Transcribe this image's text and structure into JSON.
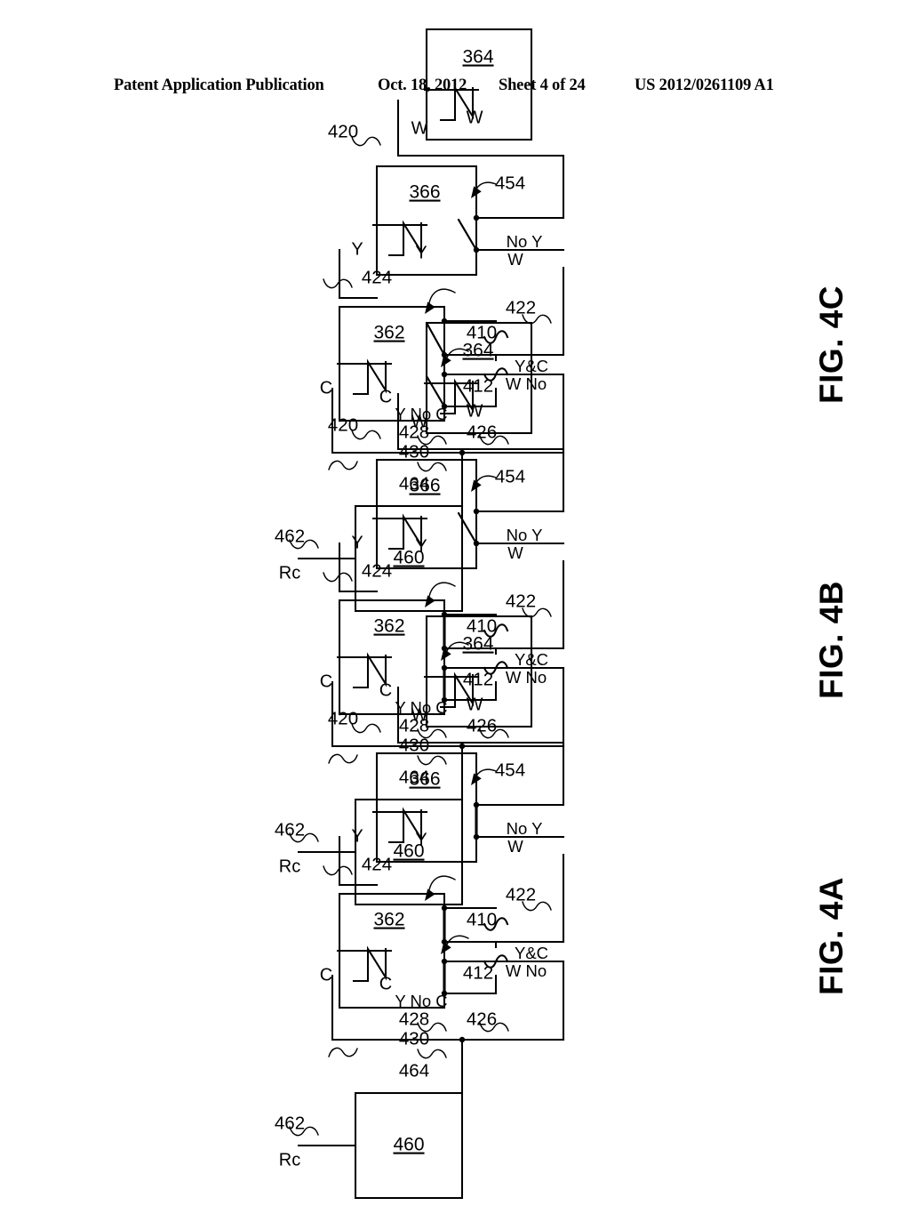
{
  "header": {
    "publication": "Patent Application Publication",
    "date": "Oct. 18, 2012",
    "sheet": "Sheet 4 of 24",
    "patent_number": "US 2012/0261109 A1"
  },
  "figures": [
    {
      "id": "fig-4c",
      "caption": "FIG. 4C",
      "controller_box": "460",
      "power_terminal": "Rc",
      "power_ref": "462",
      "leaders": [
        "464",
        "430",
        "428",
        "426",
        "422",
        "424",
        "420",
        "410",
        "412",
        "454"
      ],
      "wire_labels": {
        "y_no_c": "Y No C",
        "w_no_yc": "W No\nY&C",
        "w_no_y": "W No Y"
      },
      "relays": [
        {
          "ref": "362",
          "coil_terminal": "C",
          "contact_terminal": "C",
          "contacts": [
            {
              "ref": "412",
              "state": "open"
            },
            {
              "ref": "410",
              "state": "open"
            }
          ]
        },
        {
          "ref": "366",
          "coil_terminal": "Y",
          "contact_terminal": "Y",
          "contacts": [
            {
              "ref": "454",
              "state": "open"
            }
          ]
        },
        {
          "ref": "364",
          "coil_terminal": "W",
          "contact_terminal": "W",
          "contacts": []
        }
      ]
    },
    {
      "id": "fig-4b",
      "caption": "FIG. 4B",
      "controller_box": "460",
      "power_terminal": "Rc",
      "power_ref": "462",
      "leaders": [
        "464",
        "430",
        "428",
        "426",
        "422",
        "424",
        "420",
        "410",
        "412",
        "454"
      ],
      "wire_labels": {
        "y_no_c": "Y No C",
        "w_no_yc": "W No\nY&C",
        "w_no_y": "W No Y"
      },
      "relays": [
        {
          "ref": "362",
          "coil_terminal": "C",
          "contact_terminal": "C",
          "contacts": [
            {
              "ref": "412",
              "state": "closed"
            },
            {
              "ref": "410",
              "state": "closed"
            }
          ]
        },
        {
          "ref": "366",
          "coil_terminal": "Y",
          "contact_terminal": "Y",
          "contacts": [
            {
              "ref": "454",
              "state": "open"
            }
          ]
        },
        {
          "ref": "364",
          "coil_terminal": "W",
          "contact_terminal": "W",
          "contacts": []
        }
      ]
    },
    {
      "id": "fig-4a",
      "caption": "FIG. 4A",
      "controller_box": "460",
      "power_terminal": "Rc",
      "power_ref": "462",
      "leaders": [
        "464",
        "430",
        "428",
        "426",
        "422",
        "424",
        "420",
        "410",
        "412",
        "454"
      ],
      "wire_labels": {
        "y_no_c": "Y No C",
        "w_no_yc": "W No\nY&C",
        "w_no_y": "W No Y"
      },
      "relays": [
        {
          "ref": "362",
          "coil_terminal": "C",
          "contact_terminal": "C",
          "contacts": [
            {
              "ref": "412",
              "state": "closed"
            },
            {
              "ref": "410",
              "state": "closed"
            }
          ]
        },
        {
          "ref": "366",
          "coil_terminal": "Y",
          "contact_terminal": "Y",
          "contacts": [
            {
              "ref": "454",
              "state": "closed"
            }
          ]
        },
        {
          "ref": "364",
          "coil_terminal": "W",
          "contact_terminal": "W",
          "contacts": []
        }
      ]
    }
  ],
  "labels": {
    "ref_420": "420",
    "ref_422": "422",
    "ref_424": "424",
    "ref_426": "426",
    "ref_428": "428",
    "ref_430": "430",
    "ref_410": "410",
    "ref_412": "412",
    "ref_454": "454",
    "ref_460": "460",
    "ref_462": "462",
    "ref_464": "464",
    "ref_362": "362",
    "ref_364": "364",
    "ref_366": "366",
    "term_rc": "Rc",
    "term_c": "C",
    "term_y": "Y",
    "term_w": "W",
    "txt_y_no_c": "Y No C",
    "txt_w_no_yc_1": "W No",
    "txt_w_no_yc_2": "Y&C",
    "txt_w_no_y_1": "W",
    "txt_w_no_y_2": "No Y"
  }
}
